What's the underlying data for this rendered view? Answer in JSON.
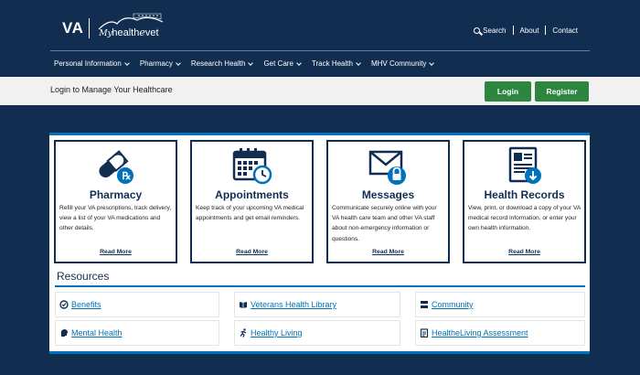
{
  "header": {
    "logo_va": "VA",
    "logo_my": "My",
    "logo_health": "health",
    "logo_e": "e",
    "logo_vet": "vet",
    "utility": {
      "search": "Search",
      "about": "About",
      "contact": "Contact"
    },
    "nav": [
      {
        "label": "Personal Information"
      },
      {
        "label": "Pharmacy"
      },
      {
        "label": "Research Health"
      },
      {
        "label": "Get Care"
      },
      {
        "label": "Track Health"
      },
      {
        "label": "MHV Community"
      }
    ]
  },
  "loginbar": {
    "message": "Login to Manage Your Healthcare",
    "login_label": "Login",
    "register_label": "Register"
  },
  "cards": [
    {
      "title": "Pharmacy",
      "icon": "pill-rx-icon",
      "description": "Refill your VA prescriptions, track delivery, view a list of your VA medications and other details.",
      "link": "Read More"
    },
    {
      "title": "Appointments",
      "icon": "calendar-clock-icon",
      "description": "Keep track of your upcoming VA medical appointments and get email reminders.",
      "link": "Read More"
    },
    {
      "title": "Messages",
      "icon": "envelope-lock-icon",
      "description": "Communicate securely online with your VA health care team and other VA staff about non-emergency information or questions.",
      "link": "Read More"
    },
    {
      "title": "Health Records",
      "icon": "record-download-icon",
      "description": "View, print, or download a copy of your VA medical record information, or enter your own health information.",
      "link": "Read More"
    }
  ],
  "resources": {
    "title": "Resources",
    "items": [
      {
        "label": "Benefits",
        "icon": "benefits-icon"
      },
      {
        "label": "Veterans Health Library",
        "icon": "book-icon"
      },
      {
        "label": "Community",
        "icon": "community-icon"
      },
      {
        "label": "Mental Health",
        "icon": "head-icon"
      },
      {
        "label": "Healthy Living",
        "icon": "runner-icon"
      },
      {
        "label": "HealtheLiving Assessment",
        "icon": "checklist-icon"
      }
    ]
  },
  "colors": {
    "navy": "#112e51",
    "blue": "#0071bc",
    "green": "#2e8540",
    "light_gray": "#f1f1f1"
  }
}
